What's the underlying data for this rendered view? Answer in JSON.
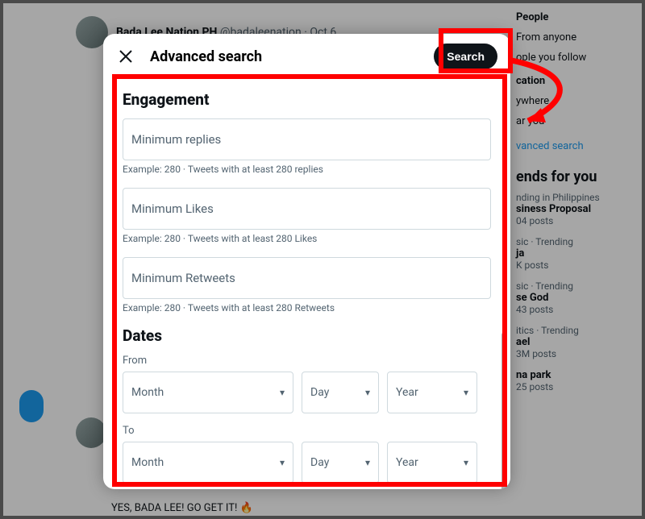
{
  "background": {
    "tweet_author": "Bada Lee Nation PH",
    "tweet_handle": "@badaleenation",
    "tweet_date": "Oct 6",
    "bottom_text": "YES, BADA LEE! GO GET IT! 🔥"
  },
  "right_sidebar": {
    "people_header": "People",
    "from_anyone": "From anyone",
    "people_follow": "ople you follow",
    "location_header": "cation",
    "anywhere": "ywhere",
    "near_you": "ar you",
    "advanced_link": "vanced search",
    "trends_header": "ends for you",
    "trend1_sub": "nding in Philippines",
    "trend1_title": "siness Proposal",
    "trend1_posts": "04 posts",
    "trend2_sub": "sic · Trending",
    "trend2_title": "ja",
    "trend2_posts": "K posts",
    "trend3_sub": "sic · Trending",
    "trend3_title": "se God",
    "trend3_posts": "43 posts",
    "trend4_sub": "itics · Trending",
    "trend4_title": "ael",
    "trend4_posts": "3M posts",
    "trend5_title": "na park",
    "trend5_posts": "25 posts"
  },
  "modal": {
    "title": "Advanced search",
    "search_button": "Search",
    "engagement_section": "Engagement",
    "min_replies_placeholder": "Minimum replies",
    "min_replies_example": "Example: 280 · Tweets with at least 280 replies",
    "min_likes_placeholder": "Minimum Likes",
    "min_likes_example": "Example: 280 · Tweets with at least 280 Likes",
    "min_retweets_placeholder": "Minimum Retweets",
    "min_retweets_example": "Example: 280 · Tweets with at least 280 Retweets",
    "dates_section": "Dates",
    "from_label": "From",
    "to_label": "To",
    "month_label": "Month",
    "day_label": "Day",
    "year_label": "Year"
  }
}
